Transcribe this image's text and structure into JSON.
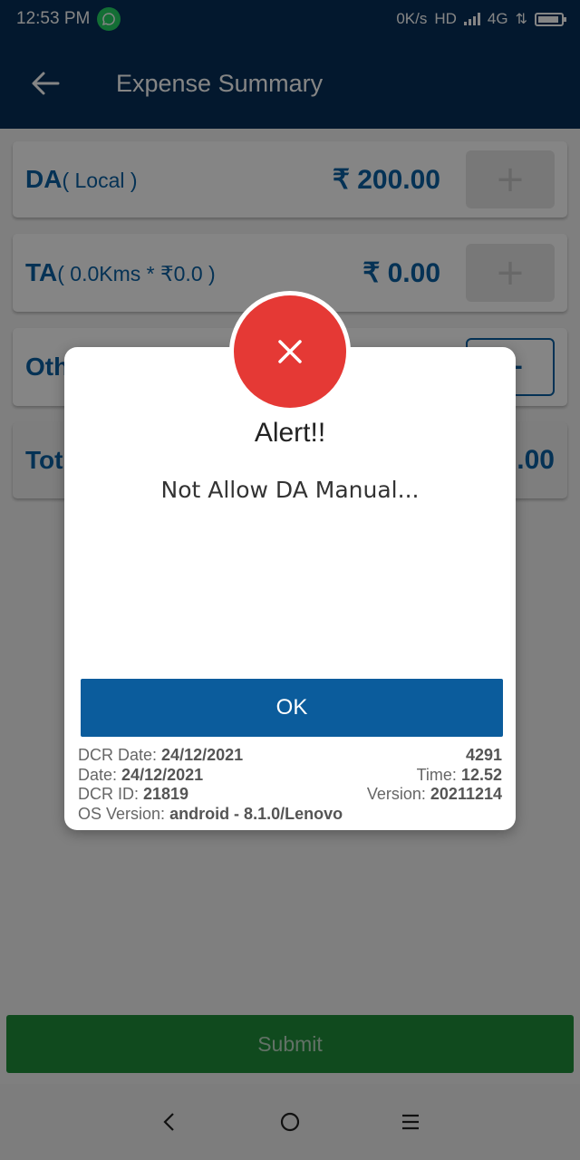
{
  "status_bar": {
    "time": "12:53 PM",
    "net_speed": "0K/s",
    "hd": "HD",
    "network": "4G",
    "icons": [
      "whatsapp-icon",
      "signal-icon",
      "data-arrows-icon",
      "battery-icon"
    ]
  },
  "app_bar": {
    "title": "Expense Summary",
    "back_icon": "arrow-left-icon"
  },
  "cards": {
    "da": {
      "label": "DA",
      "sub": "( Local )",
      "amount": "₹ 200.00",
      "button": "+"
    },
    "ta": {
      "label": "TA",
      "sub": "( 0.0Kms * ₹0.0 )",
      "amount": "₹ 0.00",
      "button": "+"
    },
    "other": {
      "label_visible": "Oth",
      "button": "+"
    },
    "total": {
      "label_visible": "Tot",
      "amount_visible": ".00"
    }
  },
  "submit": {
    "label": "Submit"
  },
  "dialog": {
    "icon": "close-icon",
    "title": "Alert!!",
    "message": "Not Allow DA Manual...",
    "ok_label": "OK",
    "meta": {
      "dcr_date_label": "DCR Date:",
      "dcr_date": "24/12/2021",
      "code": "4291",
      "date_label": "Date:",
      "date": "24/12/2021",
      "time_label": "Time:",
      "time": "12.52",
      "dcr_id_label": "DCR ID:",
      "dcr_id": "21819",
      "version_label": "Version:",
      "version": "20211214",
      "os_label": "OS Version:",
      "os": "android - 8.1.0/Lenovo"
    }
  },
  "nav_bar": {
    "icons": [
      "back-icon",
      "home-icon",
      "menu-icon"
    ]
  },
  "colors": {
    "primary_dark": "#062f58",
    "accent_blue": "#0b61a4",
    "error_red": "#e53935",
    "submit_green": "#1f8f3a"
  }
}
